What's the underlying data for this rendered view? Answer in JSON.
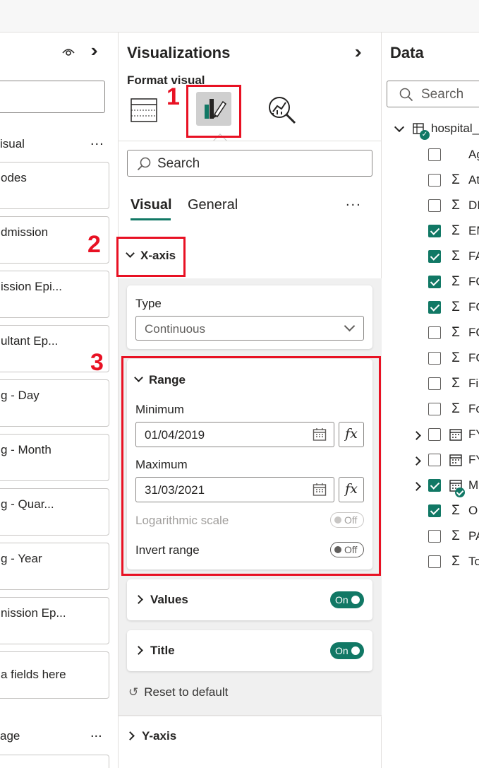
{
  "filters_pane": {
    "section_visual": "isual",
    "section_more": "...",
    "cards": [
      "odes",
      "dmission",
      "ission Epi...",
      "ultant Ep...",
      "g - Day",
      "g - Month",
      "g - Quar...",
      "g - Year",
      "nission Ep...",
      "a fields here"
    ],
    "section_page": "age",
    "page_more": "..."
  },
  "visualizations": {
    "title": "Visualizations",
    "collapse_icon": "double-chevron-right-icon",
    "format_visual_label": "Format visual",
    "tabs": [
      {
        "label": "Visual",
        "selected": true
      },
      {
        "label": "General",
        "selected": false
      }
    ],
    "more": "...",
    "search_placeholder": "Search",
    "xaxis": {
      "title": "X-axis",
      "type_label": "Type",
      "type_value": "Continuous",
      "range": {
        "title": "Range",
        "minimum_label": "Minimum",
        "minimum_value": "01/04/2019",
        "maximum_label": "Maximum",
        "maximum_value": "31/03/2021",
        "fx_label": "fx",
        "log_scale_label": "Logarithmic scale",
        "log_scale_state": "Off",
        "invert_label": "Invert range",
        "invert_state": "Off"
      },
      "values": {
        "title": "Values",
        "state": "On"
      },
      "axis_title": {
        "title": "Title",
        "state": "On"
      },
      "reset_label": "Reset to default"
    },
    "yaxis_title": "Y-axis"
  },
  "annotations": {
    "one": "1",
    "two": "2",
    "three": "3",
    "color": "#e81123"
  },
  "data_pane": {
    "title": "Data",
    "search_placeholder": "Search",
    "table_name": "hospital_",
    "fields": [
      {
        "name": "Ag",
        "type": "",
        "checked": false,
        "expandable": false
      },
      {
        "name": "At",
        "type": "Σ",
        "checked": false,
        "expandable": false
      },
      {
        "name": "DI",
        "type": "Σ",
        "checked": false,
        "expandable": false
      },
      {
        "name": "EM",
        "type": "Σ",
        "checked": true,
        "expandable": false
      },
      {
        "name": "FA",
        "type": "Σ",
        "checked": true,
        "expandable": false
      },
      {
        "name": "FC",
        "type": "Σ",
        "checked": true,
        "expandable": false
      },
      {
        "name": "FC",
        "type": "Σ",
        "checked": true,
        "expandable": false
      },
      {
        "name": "FC",
        "type": "Σ",
        "checked": false,
        "expandable": false
      },
      {
        "name": "FC",
        "type": "Σ",
        "checked": false,
        "expandable": false
      },
      {
        "name": "Fin",
        "type": "Σ",
        "checked": false,
        "expandable": false
      },
      {
        "name": "Fo",
        "type": "Σ",
        "checked": false,
        "expandable": false
      },
      {
        "name": "FY",
        "type": "calendar",
        "checked": false,
        "expandable": true
      },
      {
        "name": "FY",
        "type": "calendar",
        "checked": false,
        "expandable": true
      },
      {
        "name": "M",
        "type": "calendar",
        "checked": true,
        "expandable": true
      },
      {
        "name": "O",
        "type": "Σ",
        "checked": true,
        "expandable": false
      },
      {
        "name": "PA",
        "type": "Σ",
        "checked": false,
        "expandable": false
      },
      {
        "name": "To",
        "type": "Σ",
        "checked": false,
        "expandable": false
      }
    ]
  },
  "colors": {
    "accent": "#117865",
    "annotation": "#e81123"
  }
}
